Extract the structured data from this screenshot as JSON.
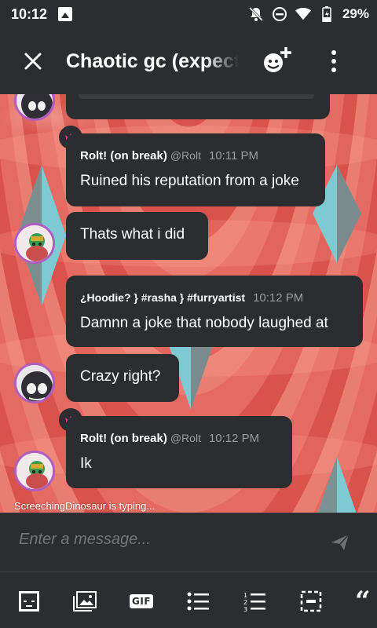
{
  "status_bar": {
    "time": "10:12",
    "battery": "29%",
    "icons": [
      "image-icon",
      "notifications-off-icon",
      "do-not-disturb-icon",
      "wifi-icon",
      "battery-icon"
    ]
  },
  "header": {
    "title": "Chaotic gc (expect",
    "icons": [
      "close-icon",
      "add-member-icon",
      "more-icon"
    ]
  },
  "messages": [
    {
      "author": "Rolt! (on break)",
      "handle": "@Rolt",
      "time": "10:11 PM",
      "text": "Ruined his reputation from a joke",
      "has_crown": true
    },
    {
      "author": "",
      "text": "Thats what i did"
    },
    {
      "author": "¿Hoodie? } #rasha } #furryartist",
      "time": "10:12 PM",
      "text": "Damnn a joke that nobody laughed at"
    },
    {
      "author": "",
      "text": "Crazy right?"
    },
    {
      "author": "Rolt! (on break)",
      "handle": "@Rolt",
      "time": "10:12 PM",
      "text": "Ik",
      "has_crown": true
    }
  ],
  "typing_indicator": "ScreechingDinosaur is typing...",
  "composer": {
    "placeholder": "Enter a message..."
  },
  "toolbar": {
    "gif_label": "GIF",
    "items": [
      "sticker-icon",
      "image-icon",
      "gif-icon",
      "bullet-list-icon",
      "numbered-list-icon",
      "spoiler-icon",
      "quote-icon"
    ]
  },
  "colors": {
    "background": "#2b2d30",
    "chat_wallpaper": "#e0605a",
    "crown_pink": "#ff2d8a",
    "avatar_border": "#b05cc0",
    "placeholder": "#8c8e91"
  }
}
